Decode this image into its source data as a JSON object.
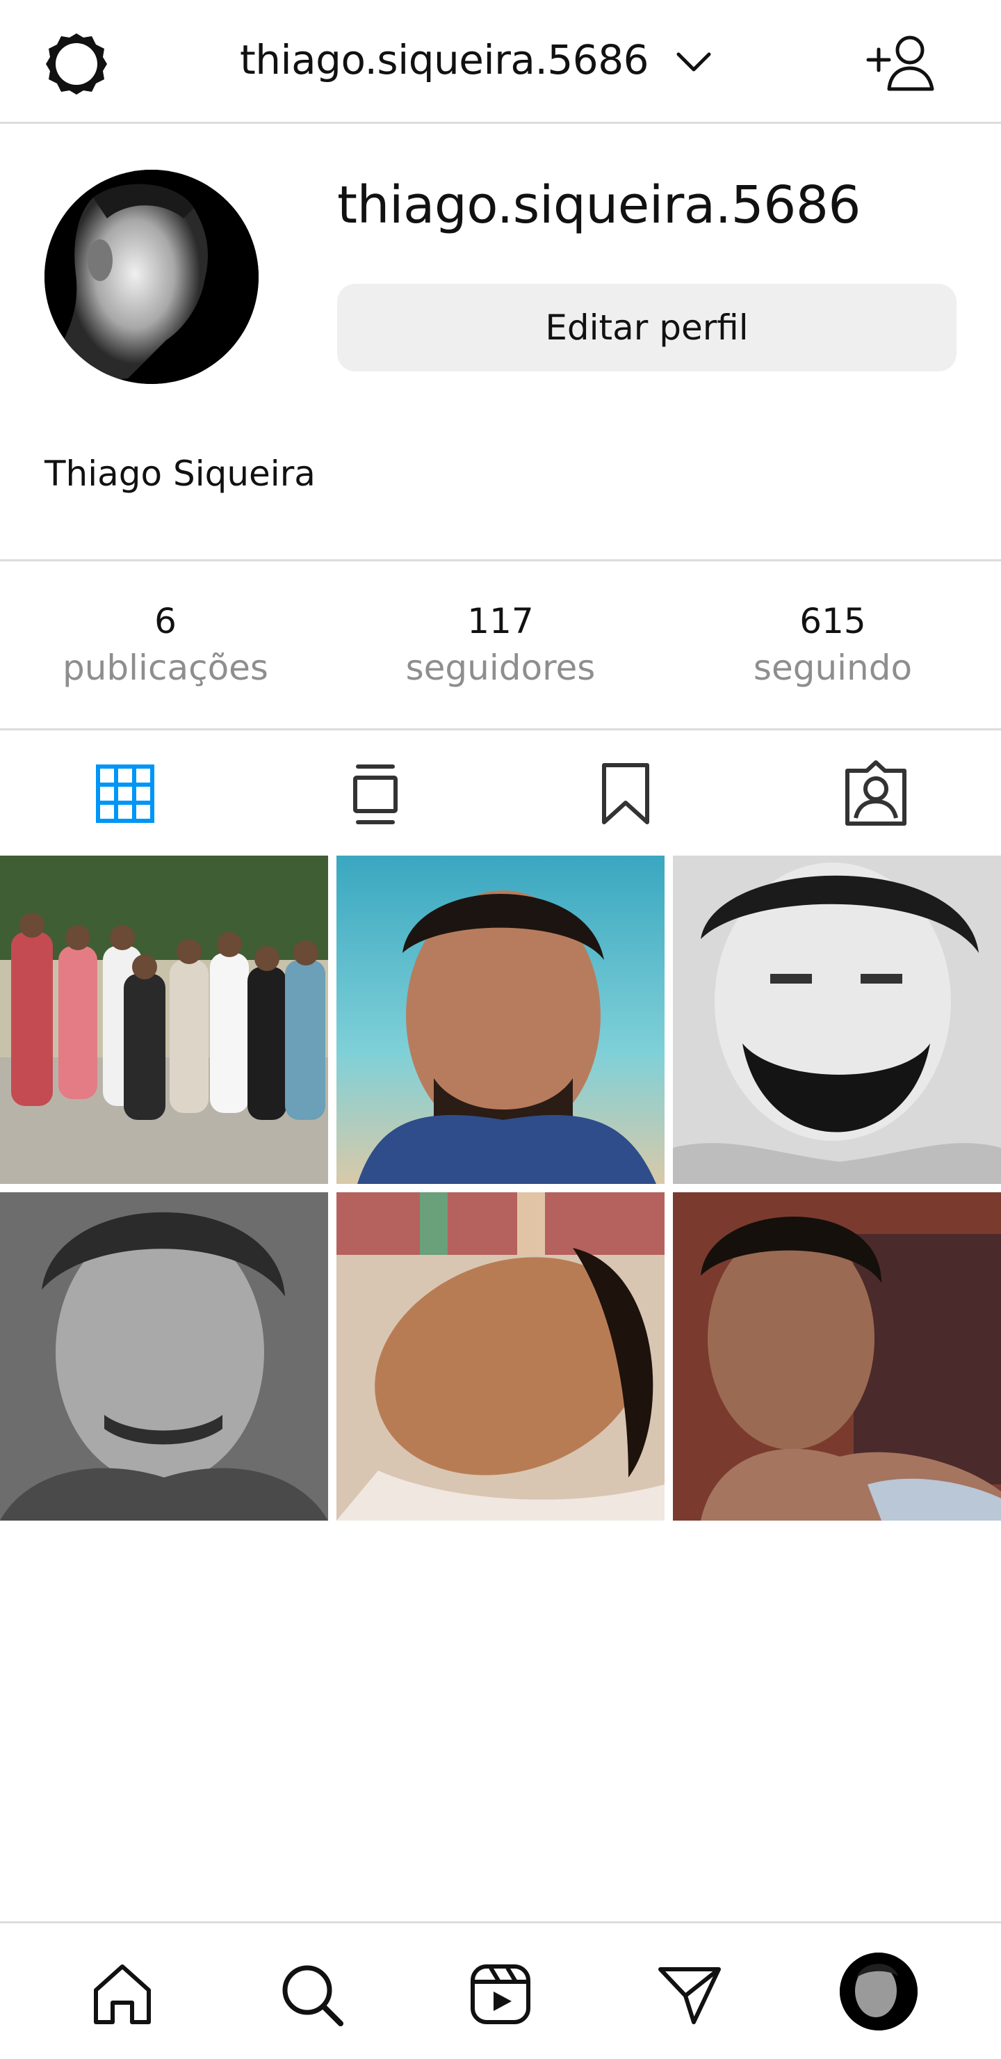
{
  "header": {
    "username": "thiago.siqueira.5686",
    "settings_icon": "settings-gear-icon",
    "switch_account_icon": "chevron-down-icon",
    "add_user_icon": "add-user-icon"
  },
  "profile": {
    "username": "thiago.siqueira.5686",
    "edit_button_label": "Editar perfil",
    "full_name": "Thiago Siqueira"
  },
  "stats": [
    {
      "value": "6",
      "label": "publicações"
    },
    {
      "value": "117",
      "label": "seguidores"
    },
    {
      "value": "615",
      "label": "seguindo"
    }
  ],
  "tabs": [
    {
      "name": "grid",
      "icon": "grid-icon",
      "active": true
    },
    {
      "name": "feed",
      "icon": "feed-icon",
      "active": false
    },
    {
      "name": "saved",
      "icon": "bookmark-icon",
      "active": false
    },
    {
      "name": "tagged",
      "icon": "tagged-person-icon",
      "active": false
    }
  ],
  "posts": [
    {
      "id": "post-1",
      "description": "group photo"
    },
    {
      "id": "post-2",
      "description": "beach selfie"
    },
    {
      "id": "post-3",
      "description": "bw bearded selfie"
    },
    {
      "id": "post-4",
      "description": "bw portrait"
    },
    {
      "id": "post-5",
      "description": "lying in bed"
    },
    {
      "id": "post-6",
      "description": "selfie on sofa"
    }
  ],
  "bottom_nav": [
    {
      "name": "home",
      "icon": "home-icon"
    },
    {
      "name": "search",
      "icon": "search-icon"
    },
    {
      "name": "reels",
      "icon": "reels-icon"
    },
    {
      "name": "direct",
      "icon": "send-icon"
    },
    {
      "name": "profile",
      "icon": "profile-avatar"
    }
  ],
  "colors": {
    "accent_blue": "#0095f6",
    "secondary_text": "#8e8e8e",
    "divider": "#dcdcdc",
    "button_bg": "#efefef"
  }
}
